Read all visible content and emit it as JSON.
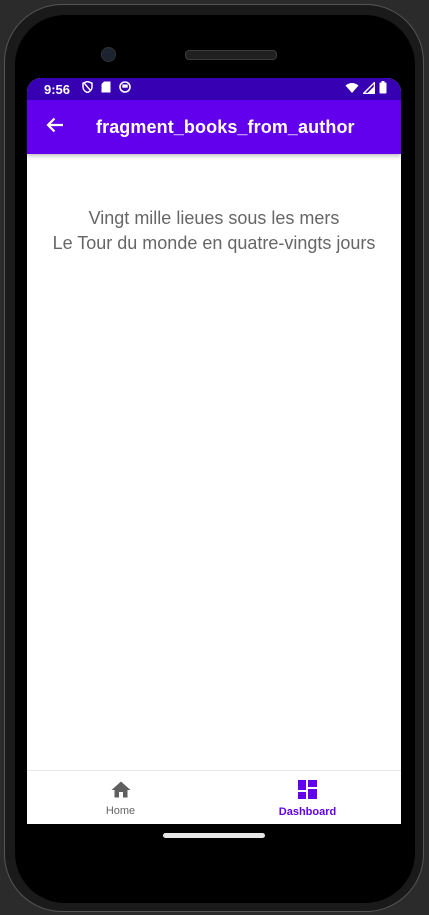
{
  "status_bar": {
    "time": "9:56",
    "left_icons": [
      "shield-icon",
      "sd-card-icon",
      "notification-icon"
    ],
    "right_icons": [
      "wifi-icon",
      "signal-icon",
      "battery-icon"
    ]
  },
  "toolbar": {
    "back_icon": "arrow-back-icon",
    "title": "fragment_books_from_author"
  },
  "books": [
    "Vingt mille lieues sous les mers",
    "Le Tour du monde en quatre-vingts jours"
  ],
  "bottom_nav": {
    "items": [
      {
        "label": "Home",
        "icon": "home-icon",
        "active": false
      },
      {
        "label": "Dashboard",
        "icon": "dashboard-icon",
        "active": true
      }
    ]
  },
  "colors": {
    "status_bar": "#3700b3",
    "primary": "#6200ee",
    "text_secondary": "#666666"
  }
}
